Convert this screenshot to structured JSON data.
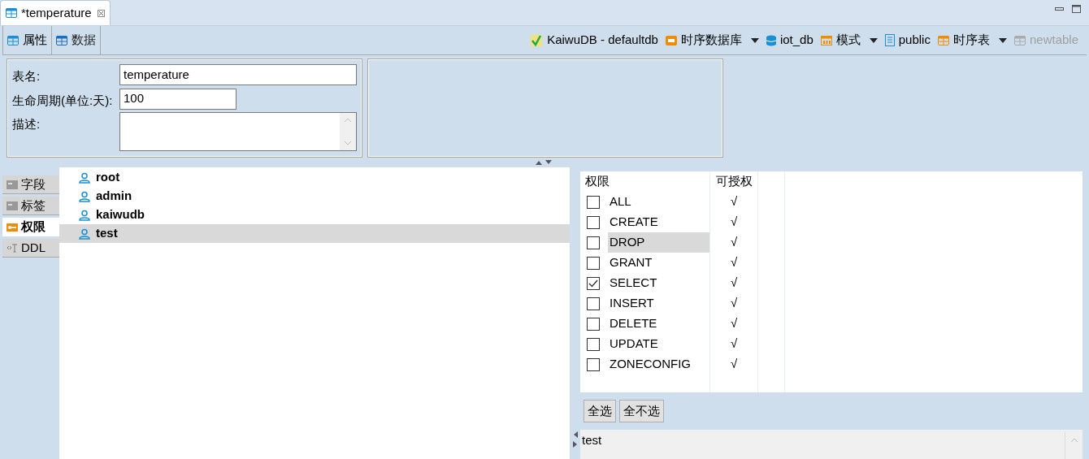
{
  "editor_tab": {
    "title": "*temperature"
  },
  "sub_tabs": [
    {
      "label": "属性",
      "selected": true
    },
    {
      "label": "数据",
      "selected": false
    }
  ],
  "breadcrumb": [
    {
      "label": "KaiwuDB - defaultdb",
      "dropdown": false,
      "disabled": false
    },
    {
      "label": "时序数据库",
      "dropdown": true,
      "disabled": false
    },
    {
      "label": "iot_db",
      "dropdown": false,
      "disabled": false
    },
    {
      "label": "模式",
      "dropdown": true,
      "disabled": false
    },
    {
      "label": "public",
      "dropdown": false,
      "disabled": false
    },
    {
      "label": "时序表",
      "dropdown": true,
      "disabled": false
    },
    {
      "label": "newtable",
      "dropdown": false,
      "disabled": true
    }
  ],
  "form": {
    "name_label": "表名:",
    "name_value": "temperature",
    "lifetime_label": "生命周期(单位:天):",
    "lifetime_value": "100",
    "description_label": "描述:"
  },
  "side_tabs": [
    {
      "label": "字段",
      "selected": false
    },
    {
      "label": "标签",
      "selected": false
    },
    {
      "label": "权限",
      "selected": true
    },
    {
      "label": "DDL",
      "selected": false
    }
  ],
  "users": [
    {
      "name": "root",
      "selected": false
    },
    {
      "name": "admin",
      "selected": false
    },
    {
      "name": "kaiwudb",
      "selected": false
    },
    {
      "name": "test",
      "selected": true
    }
  ],
  "permissions": {
    "columns": [
      "权限",
      "可授权"
    ],
    "rows": [
      {
        "name": "ALL",
        "checked": false,
        "grantable": "√",
        "selected": false
      },
      {
        "name": "CREATE",
        "checked": false,
        "grantable": "√",
        "selected": false
      },
      {
        "name": "DROP",
        "checked": false,
        "grantable": "√",
        "selected": true
      },
      {
        "name": "GRANT",
        "checked": false,
        "grantable": "√",
        "selected": false
      },
      {
        "name": "SELECT",
        "checked": true,
        "grantable": "√",
        "selected": false
      },
      {
        "name": "INSERT",
        "checked": false,
        "grantable": "√",
        "selected": false
      },
      {
        "name": "DELETE",
        "checked": false,
        "grantable": "√",
        "selected": false
      },
      {
        "name": "UPDATE",
        "checked": false,
        "grantable": "√",
        "selected": false
      },
      {
        "name": "ZONECONFIG",
        "checked": false,
        "grantable": "√",
        "selected": false
      }
    ]
  },
  "buttons": [
    "全选",
    "全不选"
  ],
  "ddl_text": "test"
}
